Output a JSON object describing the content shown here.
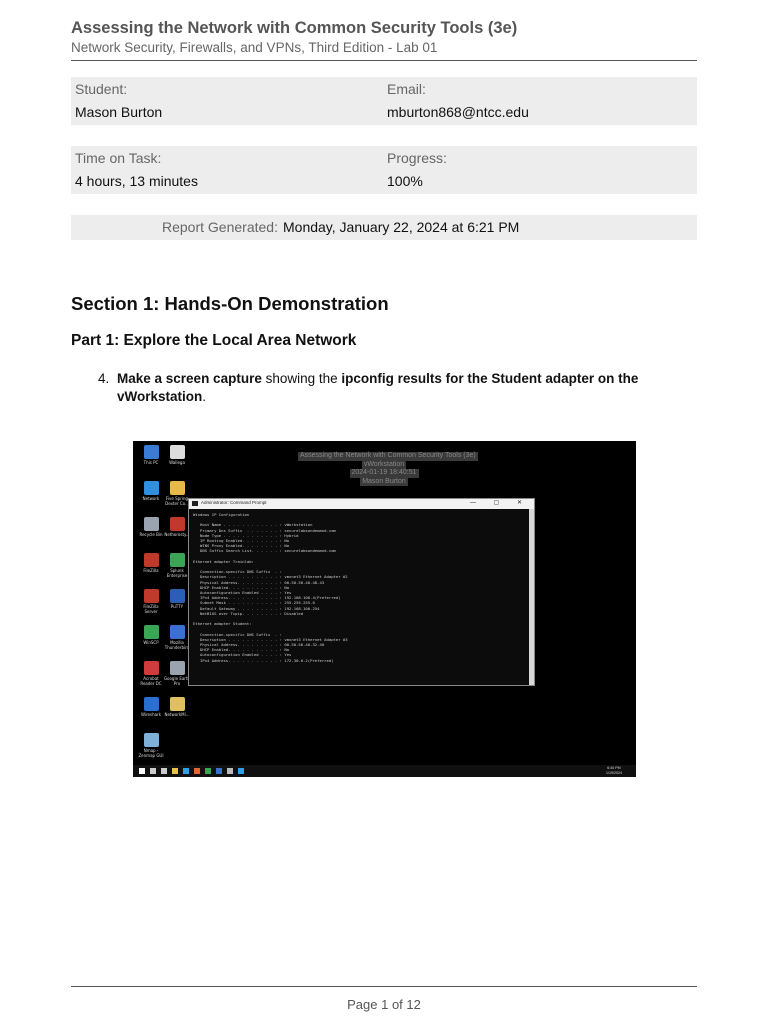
{
  "header": {
    "title": "Assessing the Network with Common Security Tools (3e)",
    "subtitle": "Network Security, Firewalls, and VPNs, Third Edition - Lab 01"
  },
  "info": {
    "student_label": "Student:",
    "student_value": "Mason Burton",
    "email_label": "Email:",
    "email_value": "mburton868@ntcc.edu",
    "time_label": "Time on Task:",
    "time_value": "4 hours, 13 minutes",
    "progress_label": "Progress:",
    "progress_value": "100%",
    "report_label": "Report Generated:",
    "report_value": "Monday, January 22, 2024 at 6:21 PM"
  },
  "section": {
    "title": "Section 1: Hands-On Demonstration",
    "part_title": "Part 1: Explore the Local Area Network"
  },
  "step": {
    "number": "4.",
    "bold1": "Make a screen capture",
    "text1": " showing the ",
    "bold2": "ipconfig results for the Student adapter on the vWorkstation",
    "text2": "."
  },
  "screenshot": {
    "wallpaper_lines": [
      "Assessing the Network with Common Security Tools (3e)",
      "vWorkstation",
      "2024-01-19 18:40:51",
      "Mason Burton"
    ],
    "desktop_icons": [
      {
        "label": "This PC",
        "color": "#3a7bd5"
      },
      {
        "label": "Wallega",
        "color": "#dddddd"
      },
      {
        "label": "Network",
        "color": "#2f8fe0"
      },
      {
        "label": "Five Spring Dexter Co...",
        "color": "#e8b84a"
      },
      {
        "label": "Recycle Bin",
        "color": "#9aa4b0"
      },
      {
        "label": "Nethorosty...",
        "color": "#c0392b"
      },
      {
        "label": "FileZilla",
        "color": "#c0392b"
      },
      {
        "label": "Splunk Enterprise",
        "color": "#3aa655"
      },
      {
        "label": "FileZilla Server",
        "color": "#c0392b"
      },
      {
        "label": "PuTTY",
        "color": "#2a5fb5"
      },
      {
        "label": "WinSCP",
        "color": "#3aa655"
      },
      {
        "label": "Mozilla Thunderbird",
        "color": "#3b6fd1"
      },
      {
        "label": "Acrobat Reader DC",
        "color": "#d13b3b"
      },
      {
        "label": "Google Earth Pro",
        "color": "#9aa4b0"
      },
      {
        "label": "Wireshark",
        "color": "#2a6fd1"
      },
      {
        "label": "NetworkMi...",
        "color": "#e0c060"
      },
      {
        "label": "Nmap - Zenmap GUI",
        "color": "#7fb0d8"
      }
    ],
    "cmd_title": "Administrator: Command Prompt",
    "cmd_controls": "— ▢ ✕",
    "cmd_lines": [
      "Windows IP Configuration",
      "",
      "   Host Name . . . . . . . . . . . . : vWorkstation",
      "   Primary Dns Suffix  . . . . . . . : securelabsondemand.com",
      "   Node Type . . . . . . . . . . . . : Hybrid",
      "   IP Routing Enabled. . . . . . . . : No",
      "   WINS Proxy Enabled. . . . . . . . : No",
      "   DNS Suffix Search List. . . . . . : securelabsondemand.com",
      "",
      "Ethernet adapter Trainlab:",
      "",
      "   Connection-specific DNS Suffix  . :",
      "   Description . . . . . . . . . . . : vmxnet3 Ethernet Adapter #2",
      "   Physical Address. . . . . . . . . : 00-50-56-40-48-43",
      "   DHCP Enabled. . . . . . . . . . . : No",
      "   Autoconfiguration Enabled . . . . : Yes",
      "   IPv4 Address. . . . . . . . . . . : 192.168.100.4(Preferred)",
      "   Subnet Mask . . . . . . . . . . . : 255.255.255.0",
      "   Default Gateway . . . . . . . . . : 192.168.100.254",
      "   NetBIOS over Tcpip. . . . . . . . : Disabled",
      "",
      "Ethernet adapter Student:",
      "",
      "   Connection-specific DNS Suffix  . :",
      "   Description . . . . . . . . . . . : vmxnet3 Ethernet Adapter #3",
      "   Physical Address. . . . . . . . . : 00-50-56-40-32-40",
      "   DHCP Enabled. . . . . . . . . . . : No",
      "   Autoconfiguration Enabled . . . . : Yes",
      "   IPv4 Address. . . . . . . . . . . : 172.30.0.2(Preferred)"
    ],
    "taskbar_icon_colors": [
      "#ffffff",
      "#cccccc",
      "#cccccc",
      "#e8c24a",
      "#2ea0e8",
      "#e0672e",
      "#3aa655",
      "#3b6fd1",
      "#bbbbbb",
      "#2ea0e8"
    ],
    "clock_time": "6:40 PM",
    "clock_date": "1/19/2024"
  },
  "footer": {
    "page": "Page 1 of 12"
  }
}
